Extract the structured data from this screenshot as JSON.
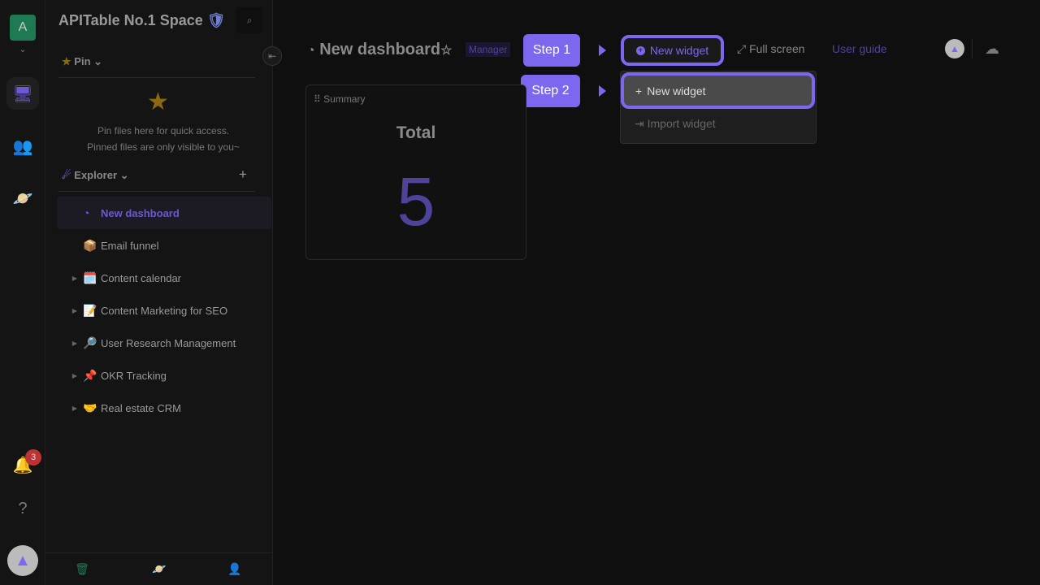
{
  "rail": {
    "avatar_letter": "A",
    "notification_count": "3"
  },
  "sidebar": {
    "space_title": "APITable No.1 Space",
    "pin": {
      "label": "Pin",
      "empty_line1": "Pin files here for quick access.",
      "empty_line2": "Pinned files are only visible to you~"
    },
    "explorer": {
      "label": "Explorer"
    },
    "items": [
      {
        "label": "New dashboard",
        "icon": "dashboard-icon",
        "active": true
      },
      {
        "label": "Email funnel",
        "emoji": "📦"
      },
      {
        "label": "Content calendar",
        "emoji": "🗓️"
      },
      {
        "label": "Content Marketing for SEO",
        "emoji": "📝"
      },
      {
        "label": "User Research Management",
        "emoji": "🔎"
      },
      {
        "label": "OKR Tracking",
        "emoji": "📌"
      },
      {
        "label": "Real estate CRM",
        "emoji": "🤝"
      }
    ]
  },
  "header": {
    "title": "New dashboard",
    "role_badge": "Manager",
    "new_widget": "New widget",
    "full_screen": "Full screen",
    "user_guide": "User guide"
  },
  "guide": {
    "step1": "Step 1",
    "step2": "Step 2"
  },
  "menu": {
    "new_widget": "New widget",
    "import_widget": "Import widget"
  },
  "widget": {
    "name": "Summary",
    "title": "Total",
    "value": "5"
  },
  "colors": {
    "accent": "#7b68ee",
    "bg": "#0f0f0f"
  }
}
